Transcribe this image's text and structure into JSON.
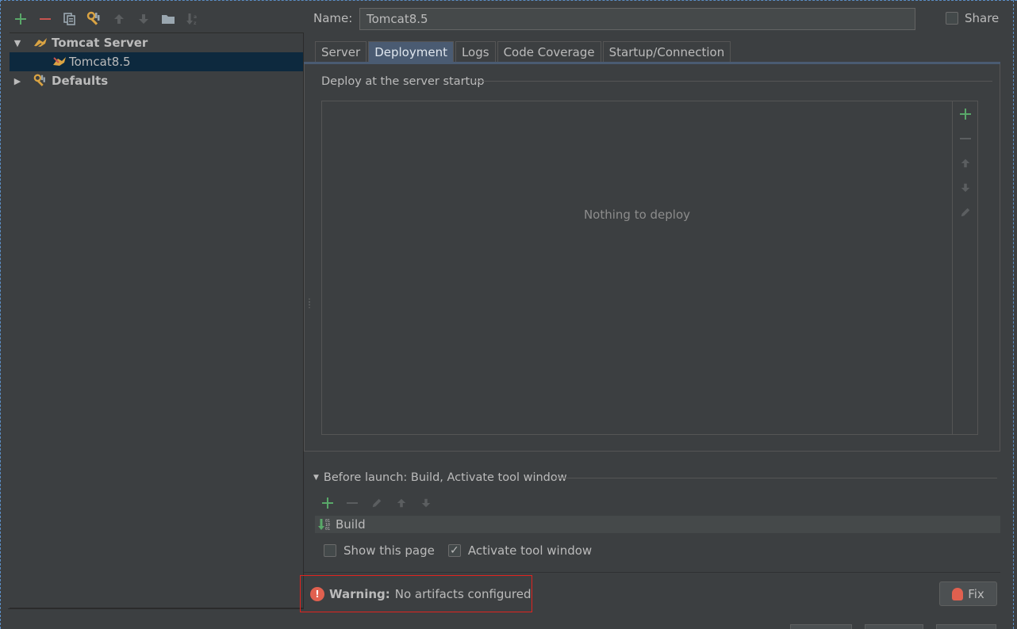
{
  "toolbar": {
    "add": "add-icon",
    "remove": "remove-icon",
    "copy": "copy-icon",
    "settings": "wrench-icon",
    "up": "arrow-up-icon",
    "down": "arrow-down-icon",
    "folder": "folder-icon",
    "sort": "sort-icon"
  },
  "tree": {
    "group": "Tomcat Server",
    "item": "Tomcat8.5",
    "defaults": "Defaults"
  },
  "name": {
    "label": "Name:",
    "value": "Tomcat8.5"
  },
  "share": {
    "label": "Share",
    "checked": false
  },
  "tabs": [
    {
      "label": "Server"
    },
    {
      "label": "Deployment"
    },
    {
      "label": "Logs"
    },
    {
      "label": "Code Coverage"
    },
    {
      "label": "Startup/Connection"
    }
  ],
  "deployment": {
    "section_title": "Deploy at the server startup",
    "empty_text": "Nothing to deploy"
  },
  "before_launch": {
    "title": "Before launch: Build, Activate tool window",
    "items": [
      {
        "label": "Build"
      }
    ],
    "show_page": "Show this page",
    "activate_tool": "Activate tool window",
    "show_page_checked": false,
    "activate_tool_checked": true
  },
  "warning": {
    "bold": "Warning:",
    "text": "No artifacts configured"
  },
  "fix_label": "Fix",
  "colors": {
    "background": "#3c3f41",
    "selection": "#0d293e",
    "active_tab": "#4a5b72",
    "add_green": "#59a869",
    "remove_red": "#c75450",
    "warning_border": "#e0231f"
  }
}
